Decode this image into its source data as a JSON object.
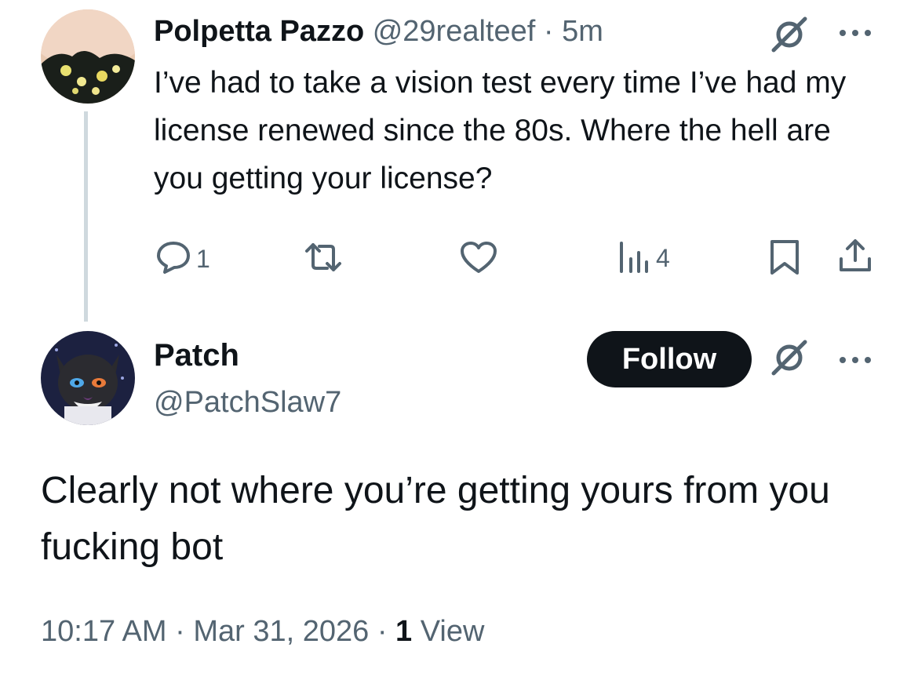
{
  "reply": {
    "name": "Polpetta Pazzo",
    "handle": "@29realteef",
    "separator": "·",
    "time": "5m",
    "text": "I’ve had to take a vision test every time I’ve had my license renewed since the 80s. Where the hell are you getting your license?",
    "actions": {
      "reply_count": "1",
      "views_count": "4"
    }
  },
  "main": {
    "name": "Patch",
    "handle": "@PatchSlaw7",
    "follow_label": "Follow",
    "text": "Clearly not where you’re getting yours from you fucking bot",
    "time": "10:17 AM",
    "separator1": "·",
    "date": "Mar 31, 2026",
    "separator2": "·",
    "views_count": "1",
    "views_label": "View"
  },
  "icons": {
    "reply": "comment-icon",
    "retweet": "retweet-icon",
    "like": "heart-icon",
    "views": "analytics-icon",
    "bookmark": "bookmark-icon",
    "share": "share-icon",
    "grok": "grok-icon",
    "more": "more-icon"
  },
  "colors": {
    "text": "#0f1419",
    "secondary": "#536471",
    "thread_line": "#cfd9de",
    "follow_bg": "#0f1419"
  }
}
